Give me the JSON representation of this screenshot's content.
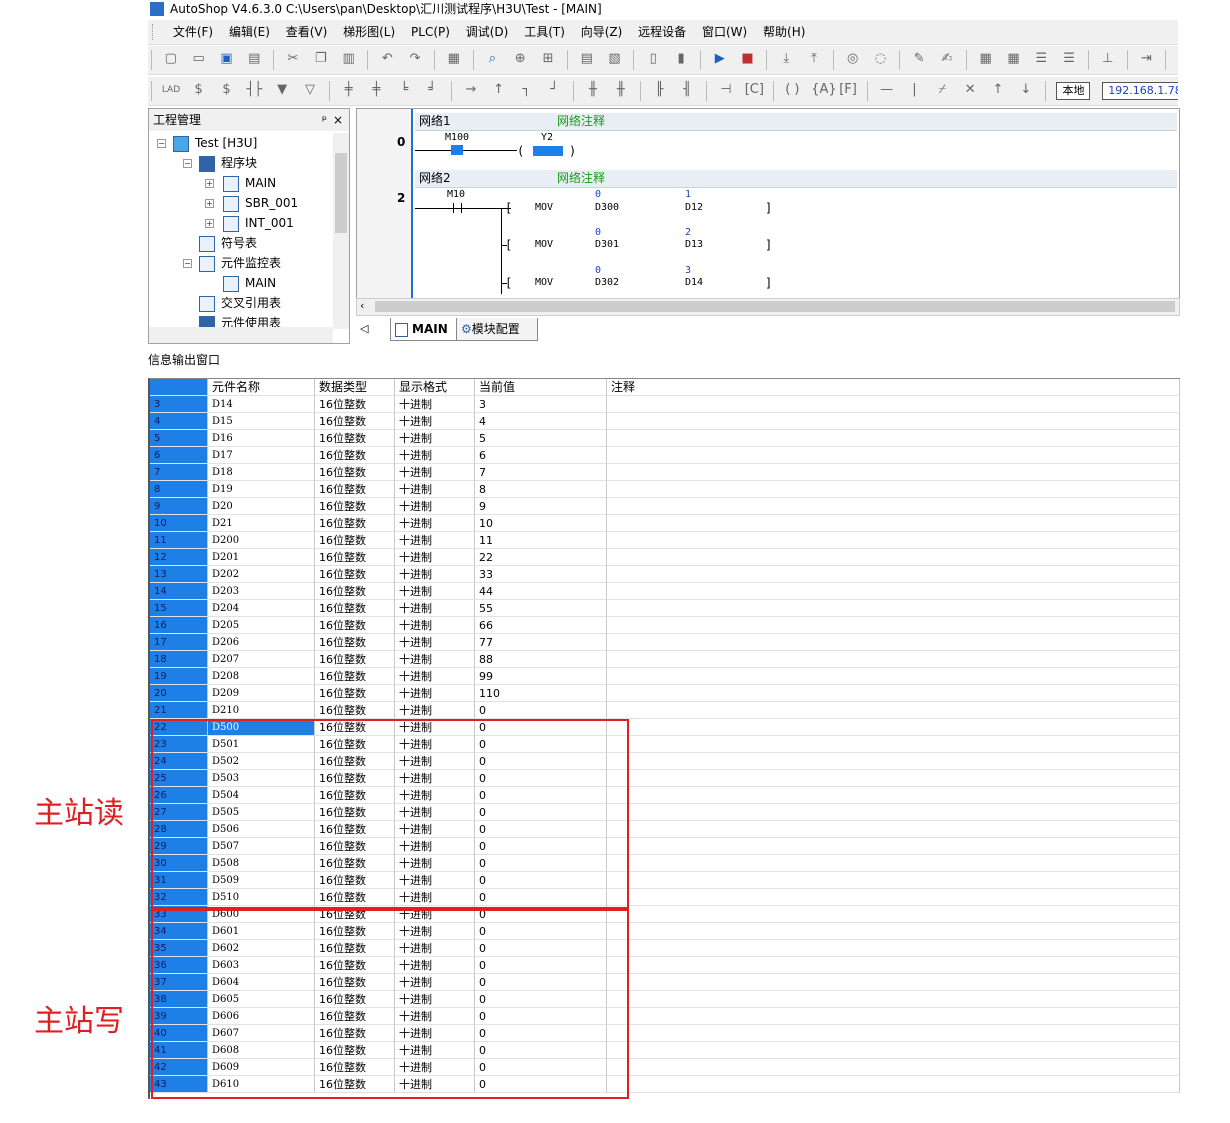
{
  "app": {
    "title": "AutoShop V4.6.3.0  C:\\Users\\pan\\Desktop\\汇川测试程序\\H3U\\Test - [MAIN]"
  },
  "menu": [
    "文件(F)",
    "编辑(E)",
    "查看(V)",
    "梯形图(L)",
    "PLC(P)",
    "调试(D)",
    "工具(T)",
    "向导(Z)",
    "远程设备",
    "窗口(W)",
    "帮助(H)"
  ],
  "toolbar": {
    "local_label": "本地",
    "ip": "192.168.1.78"
  },
  "project": {
    "title": "工程管理",
    "pin": "ᵖ",
    "close": "×",
    "nodes": [
      "Test [H3U]",
      "程序块",
      "MAIN",
      "SBR_001",
      "INT_001",
      "符号表",
      "元件监控表",
      "MAIN",
      "交叉引用表",
      "元件使用表"
    ]
  },
  "ladder": {
    "net1": {
      "label": "网络1",
      "comment": "网络注释",
      "step": "0",
      "contact": "M100",
      "coil": "Y2"
    },
    "net2": {
      "label": "网络2",
      "comment": "网络注释",
      "step": "2",
      "contact": "M10",
      "instr": [
        {
          "op": "MOV",
          "src_val": "0",
          "src": "D300",
          "dst_val": "1",
          "dst": "D12"
        },
        {
          "op": "MOV",
          "src_val": "0",
          "src": "D301",
          "dst_val": "2",
          "dst": "D13"
        },
        {
          "op": "MOV",
          "src_val": "0",
          "src": "D302",
          "dst_val": "3",
          "dst": "D14"
        }
      ]
    }
  },
  "tabs": {
    "main": "MAIN",
    "module": "模块配置"
  },
  "info": {
    "title": "信息输出窗口"
  },
  "table": {
    "headers": [
      "",
      "元件名称",
      "数据类型",
      "显示格式",
      "当前值",
      "注释"
    ],
    "rows": [
      [
        "3",
        "D14",
        "16位整数",
        "十进制",
        "3"
      ],
      [
        "4",
        "D15",
        "16位整数",
        "十进制",
        "4"
      ],
      [
        "5",
        "D16",
        "16位整数",
        "十进制",
        "5"
      ],
      [
        "6",
        "D17",
        "16位整数",
        "十进制",
        "6"
      ],
      [
        "7",
        "D18",
        "16位整数",
        "十进制",
        "7"
      ],
      [
        "8",
        "D19",
        "16位整数",
        "十进制",
        "8"
      ],
      [
        "9",
        "D20",
        "16位整数",
        "十进制",
        "9"
      ],
      [
        "10",
        "D21",
        "16位整数",
        "十进制",
        "10"
      ],
      [
        "11",
        "D200",
        "16位整数",
        "十进制",
        "11"
      ],
      [
        "12",
        "D201",
        "16位整数",
        "十进制",
        "22"
      ],
      [
        "13",
        "D202",
        "16位整数",
        "十进制",
        "33"
      ],
      [
        "14",
        "D203",
        "16位整数",
        "十进制",
        "44"
      ],
      [
        "15",
        "D204",
        "16位整数",
        "十进制",
        "55"
      ],
      [
        "16",
        "D205",
        "16位整数",
        "十进制",
        "66"
      ],
      [
        "17",
        "D206",
        "16位整数",
        "十进制",
        "77"
      ],
      [
        "18",
        "D207",
        "16位整数",
        "十进制",
        "88"
      ],
      [
        "19",
        "D208",
        "16位整数",
        "十进制",
        "99"
      ],
      [
        "20",
        "D209",
        "16位整数",
        "十进制",
        "110"
      ],
      [
        "21",
        "D210",
        "16位整数",
        "十进制",
        "0"
      ],
      [
        "22",
        "D500",
        "16位整数",
        "十进制",
        "0"
      ],
      [
        "23",
        "D501",
        "16位整数",
        "十进制",
        "0"
      ],
      [
        "24",
        "D502",
        "16位整数",
        "十进制",
        "0"
      ],
      [
        "25",
        "D503",
        "16位整数",
        "十进制",
        "0"
      ],
      [
        "26",
        "D504",
        "16位整数",
        "十进制",
        "0"
      ],
      [
        "27",
        "D505",
        "16位整数",
        "十进制",
        "0"
      ],
      [
        "28",
        "D506",
        "16位整数",
        "十进制",
        "0"
      ],
      [
        "29",
        "D507",
        "16位整数",
        "十进制",
        "0"
      ],
      [
        "30",
        "D508",
        "16位整数",
        "十进制",
        "0"
      ],
      [
        "31",
        "D509",
        "16位整数",
        "十进制",
        "0"
      ],
      [
        "32",
        "D510",
        "16位整数",
        "十进制",
        "0"
      ],
      [
        "33",
        "D600",
        "16位整数",
        "十进制",
        "0"
      ],
      [
        "34",
        "D601",
        "16位整数",
        "十进制",
        "0"
      ],
      [
        "35",
        "D602",
        "16位整数",
        "十进制",
        "0"
      ],
      [
        "36",
        "D603",
        "16位整数",
        "十进制",
        "0"
      ],
      [
        "37",
        "D604",
        "16位整数",
        "十进制",
        "0"
      ],
      [
        "38",
        "D605",
        "16位整数",
        "十进制",
        "0"
      ],
      [
        "39",
        "D606",
        "16位整数",
        "十进制",
        "0"
      ],
      [
        "40",
        "D607",
        "16位整数",
        "十进制",
        "0"
      ],
      [
        "41",
        "D608",
        "16位整数",
        "十进制",
        "0"
      ],
      [
        "42",
        "D609",
        "16位整数",
        "十进制",
        "0"
      ],
      [
        "43",
        "D610",
        "16位整数",
        "十进制",
        "0"
      ]
    ],
    "selected_row": 19
  },
  "annotations": {
    "read": "主站读",
    "write": "主站写",
    "color": "#e02020"
  }
}
